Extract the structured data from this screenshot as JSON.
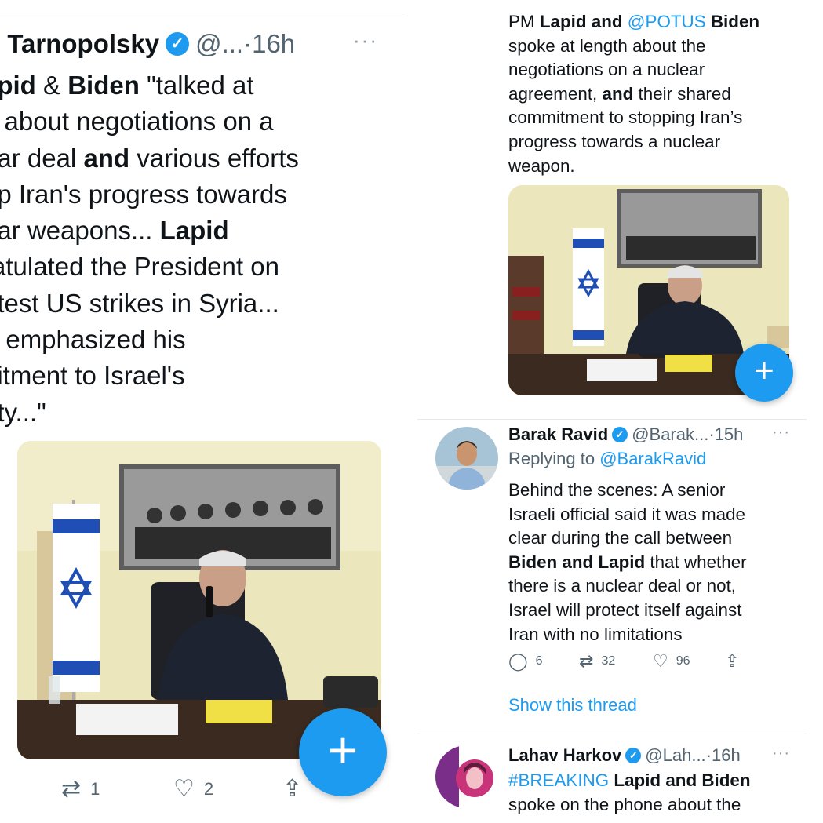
{
  "left_tweet": {
    "name": "n Tarnopolsky",
    "handle": "@...",
    "time": "·16h",
    "more": "···",
    "lines": [
      [
        {
          "t": "apid",
          "b": true
        },
        {
          "t": " & ",
          "b": false
        },
        {
          "t": "Biden",
          "b": true
        },
        {
          "t": " \"talked at",
          "b": false
        }
      ],
      [
        {
          "t": "h about negotiations on a",
          "b": false
        }
      ],
      [
        {
          "t": "ear deal ",
          "b": false
        },
        {
          "t": "and",
          "b": true
        },
        {
          "t": " various efforts",
          "b": false
        }
      ],
      [
        {
          "t": "op Iran's progress towards",
          "b": false
        }
      ],
      [
        {
          "t": "ear weapons... ",
          "b": false
        },
        {
          "t": "Lapid",
          "b": true
        }
      ],
      [
        {
          "t": "ratulated the President on",
          "b": false
        }
      ],
      [
        {
          "t": "atest US strikes in Syria...",
          "b": false
        }
      ],
      [
        {
          "t": "n",
          "b": true
        },
        {
          "t": " emphasized his",
          "b": false
        }
      ],
      [
        {
          "t": "nitment to Israel's",
          "b": false
        }
      ],
      [
        {
          "t": "rity...\"",
          "b": false
        }
      ]
    ],
    "retweet_count": "1",
    "like_count": "2",
    "fab_label": "+"
  },
  "right_tweet_1": {
    "lines": [
      [
        {
          "t": "PM ",
          "b": false
        },
        {
          "t": "Lapid and ",
          "b": true
        },
        {
          "t": "@POTUS",
          "b": false,
          "l": true
        },
        {
          "t": " Biden",
          "b": true
        }
      ],
      [
        {
          "t": "spoke at length about the",
          "b": false
        }
      ],
      [
        {
          "t": "negotiations on a nuclear",
          "b": false
        }
      ],
      [
        {
          "t": "agreement, ",
          "b": false
        },
        {
          "t": "and",
          "b": true
        },
        {
          "t": " their shared",
          "b": false
        }
      ],
      [
        {
          "t": "commitment to stopping Iran’s",
          "b": false
        }
      ],
      [
        {
          "t": "progress towards a nuclear",
          "b": false
        }
      ],
      [
        {
          "t": "weapon.",
          "b": false
        }
      ]
    ],
    "fab_label": "+"
  },
  "right_tweet_2": {
    "name": "Barak Ravid",
    "handle": "@Barak...",
    "time": "·15h",
    "more": "···",
    "replying_prefix": "Replying to ",
    "replying_handle": "@BarakRavid",
    "lines": [
      [
        {
          "t": "Behind the scenes: A senior",
          "b": false
        }
      ],
      [
        {
          "t": "Israeli official said it was made",
          "b": false
        }
      ],
      [
        {
          "t": "clear during the call between",
          "b": false
        }
      ],
      [
        {
          "t": "Biden and Lapid",
          "b": true
        },
        {
          "t": " that whether",
          "b": false
        }
      ],
      [
        {
          "t": "there is a nuclear deal or not,",
          "b": false
        }
      ],
      [
        {
          "t": "Israel will protect itself against",
          "b": false
        }
      ],
      [
        {
          "t": "Iran with no limitations",
          "b": false
        }
      ]
    ],
    "reply_count": "6",
    "retweet_count": "32",
    "like_count": "96",
    "show_thread": "Show this thread"
  },
  "right_tweet_3": {
    "name": "Lahav Harkov",
    "handle": "@Lah...",
    "time": "·16h",
    "more": "···",
    "lines": [
      [
        {
          "t": "#BREAKING",
          "b": false,
          "l": true
        },
        {
          "t": " Lapid and Biden",
          "b": true
        }
      ],
      [
        {
          "t": "spoke on the phone about the",
          "b": false
        }
      ]
    ]
  },
  "icons": {
    "verified": "verified-badge-icon",
    "reply": "reply-icon",
    "retweet": "retweet-icon",
    "like": "heart-icon",
    "share": "share-icon",
    "more": "more-icon",
    "compose": "compose-plus-icon"
  },
  "colors": {
    "accent": "#1d9bf0",
    "text": "#0f1419",
    "secondary": "#536471",
    "divider": "#e6e9eb"
  }
}
